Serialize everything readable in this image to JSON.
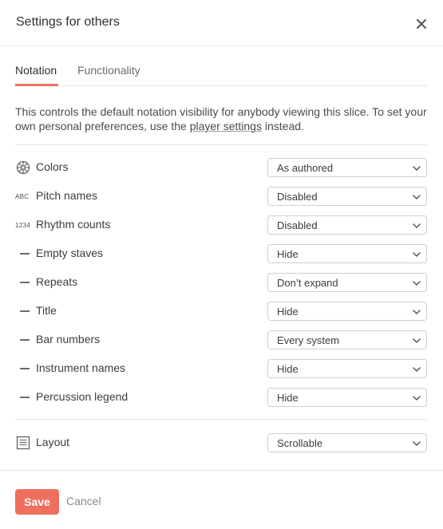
{
  "dialog": {
    "title": "Settings for others",
    "close_icon": "close-icon"
  },
  "tabs": [
    {
      "label": "Notation",
      "active": true
    },
    {
      "label": "Functionality",
      "active": false
    }
  ],
  "description": {
    "text_before": "This controls the default notation visibility for anybody viewing this slice. To set your own personal preferences, use the ",
    "link": "player settings",
    "text_after": " instead."
  },
  "settings": [
    {
      "icon": "color-wheel-icon",
      "label": "Colors",
      "value": "As authored"
    },
    {
      "icon": "abc-icon",
      "icon_text": "ABC",
      "label": "Pitch names",
      "value": "Disabled"
    },
    {
      "icon": "1234-icon",
      "icon_text": "1234",
      "label": "Rhythm counts",
      "value": "Disabled"
    },
    {
      "icon": "dash-icon",
      "label": "Empty staves",
      "value": "Hide"
    },
    {
      "icon": "dash-icon",
      "label": "Repeats",
      "value": "Don’t expand"
    },
    {
      "icon": "dash-icon",
      "label": "Title",
      "value": "Hide"
    },
    {
      "icon": "dash-icon",
      "label": "Bar numbers",
      "value": "Every system"
    },
    {
      "icon": "dash-icon",
      "label": "Instrument names",
      "value": "Hide"
    },
    {
      "icon": "dash-icon",
      "label": "Percussion legend",
      "value": "Hide"
    }
  ],
  "layout_setting": {
    "icon": "document-icon",
    "label": "Layout",
    "value": "Scrollable"
  },
  "footer": {
    "save_label": "Save",
    "cancel_label": "Cancel"
  },
  "colors": {
    "accent": "#ef6f5e",
    "border": "#e6e6e6",
    "select_border": "#cfcfcf"
  }
}
